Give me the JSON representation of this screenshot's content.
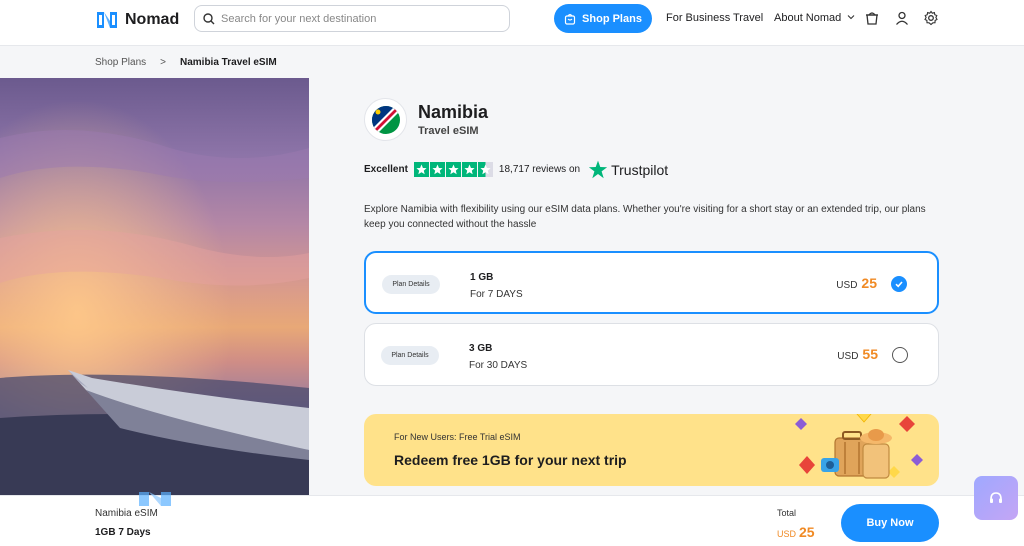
{
  "header": {
    "logo_text": "Nomad",
    "search_placeholder": "Search for your next destination",
    "shop_plans": "Shop Plans",
    "for_business": "For Business",
    "travel": "Travel",
    "about": "About Nomad"
  },
  "breadcrumb": {
    "items": [
      "Shop Plans",
      "Namibia Travel eSIM"
    ],
    "separator": ">"
  },
  "product": {
    "country": "Namibia",
    "subtitle": "Travel eSIM",
    "rating_word": "Excellent",
    "reviews": "18,717 reviews on",
    "trustpilot": "Trustpilot",
    "rating_stars": 4.5,
    "description": "Explore Namibia with flexibility using our eSIM data plans. Whether you're visiting for a short stay or an extended trip, our plans keep you connected without the hassle"
  },
  "plans": [
    {
      "chip": "Plan Details",
      "data": "1 GB",
      "days": "For 7 DAYS",
      "currency": "USD",
      "price": "25",
      "selected": true
    },
    {
      "chip": "Plan Details",
      "data": "3 GB",
      "days": "For 30 DAYS",
      "currency": "USD",
      "price": "55",
      "selected": false
    }
  ],
  "promo": {
    "small": "For New Users: Free Trial eSIM",
    "big": "Redeem free 1GB for your next trip"
  },
  "bottom": {
    "name": "Namibia eSIM",
    "plan": "1GB 7 Days",
    "total_label": "Total",
    "currency": "USD",
    "price": "25",
    "buy": "Buy Now"
  },
  "colors": {
    "accent": "#1a8fff",
    "price": "#f08a24",
    "trustpilot": "#00b67a",
    "promo_bg": "#ffe28a"
  }
}
